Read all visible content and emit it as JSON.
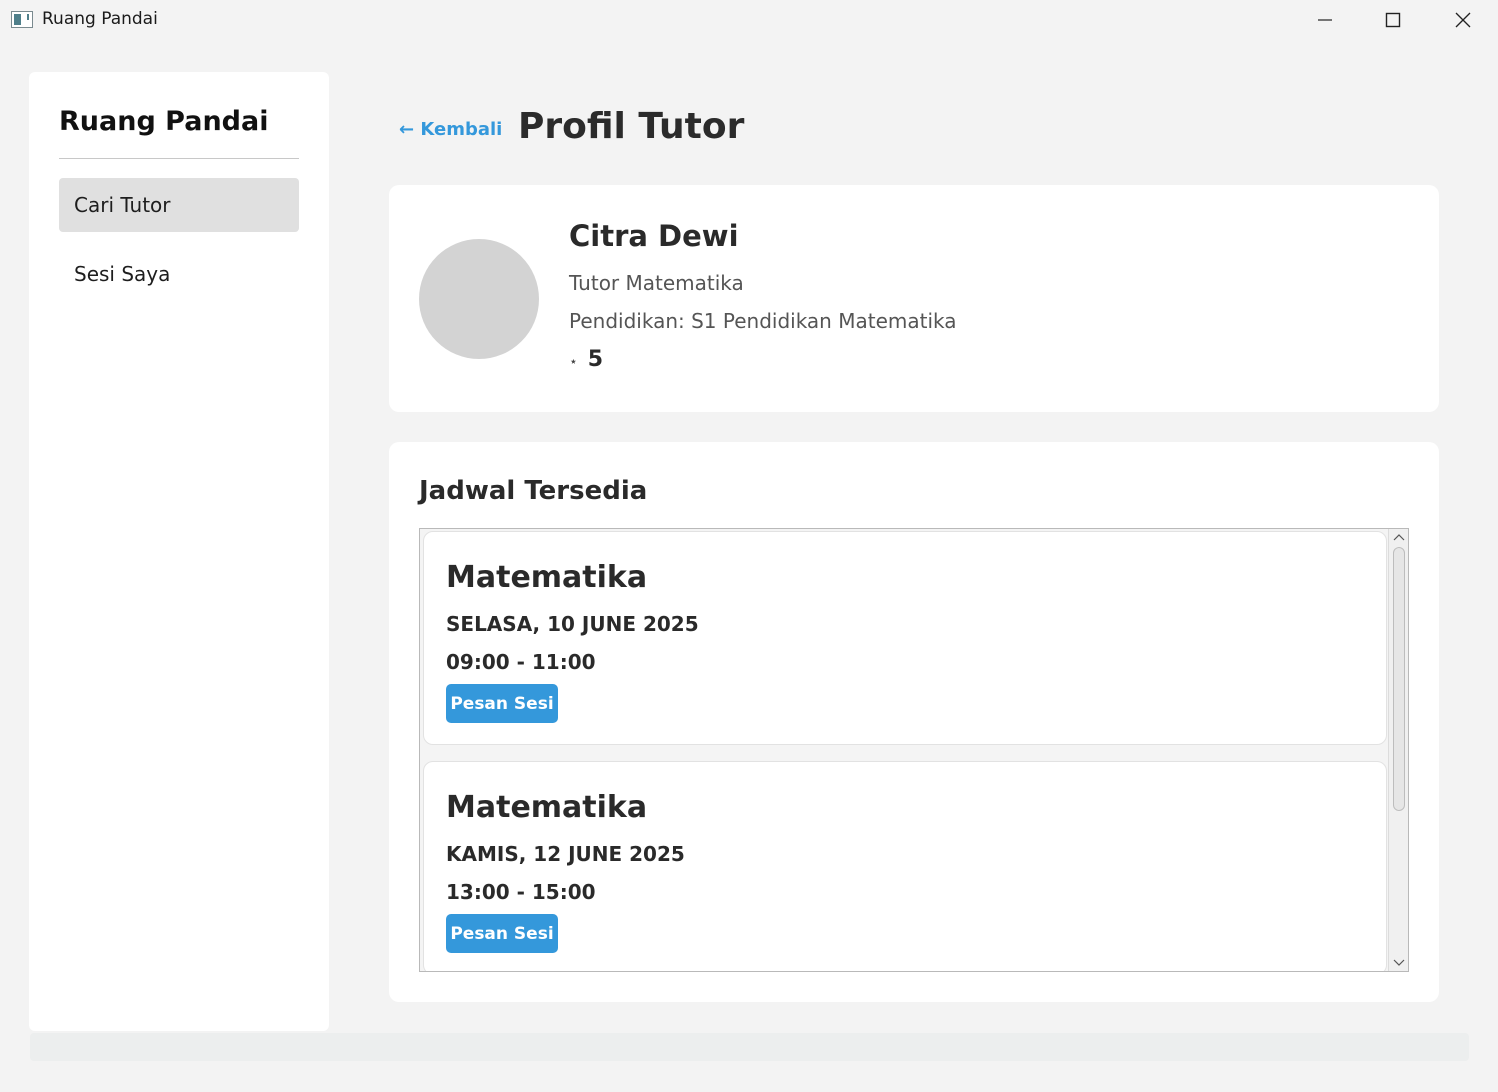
{
  "window": {
    "title": "Ruang Pandai",
    "icons": {
      "app": "app-window-icon",
      "minimize": "minimize-icon",
      "maximize": "maximize-icon",
      "close": "close-icon"
    }
  },
  "sidebar": {
    "brand": "Ruang Pandai",
    "items": [
      {
        "label": "Cari Tutor",
        "active": true
      },
      {
        "label": "Sesi Saya",
        "active": false
      }
    ]
  },
  "header": {
    "back_label": "← Kembali",
    "title": "Profil Tutor"
  },
  "profile": {
    "name": "Citra Dewi",
    "role": "Tutor Matematika",
    "education": "Pendidikan: S1 Pendidikan Matematika",
    "rating_icon": "⋆",
    "rating": "5"
  },
  "schedule": {
    "title": "Jadwal Tersedia",
    "slots": [
      {
        "subject": "Matematika",
        "date": "SELASA, 10 JUNE 2025",
        "time": "09:00 - 11:00",
        "button": "Pesan Sesi"
      },
      {
        "subject": "Matematika",
        "date": "KAMIS, 12 JUNE 2025",
        "time": "13:00 - 15:00",
        "button": "Pesan Sesi"
      }
    ]
  },
  "colors": {
    "accent": "#3498db",
    "background": "#f3f3f3",
    "card": "#ffffff",
    "avatar": "#d3d3d3",
    "nav_active": "#e0e0e0"
  }
}
